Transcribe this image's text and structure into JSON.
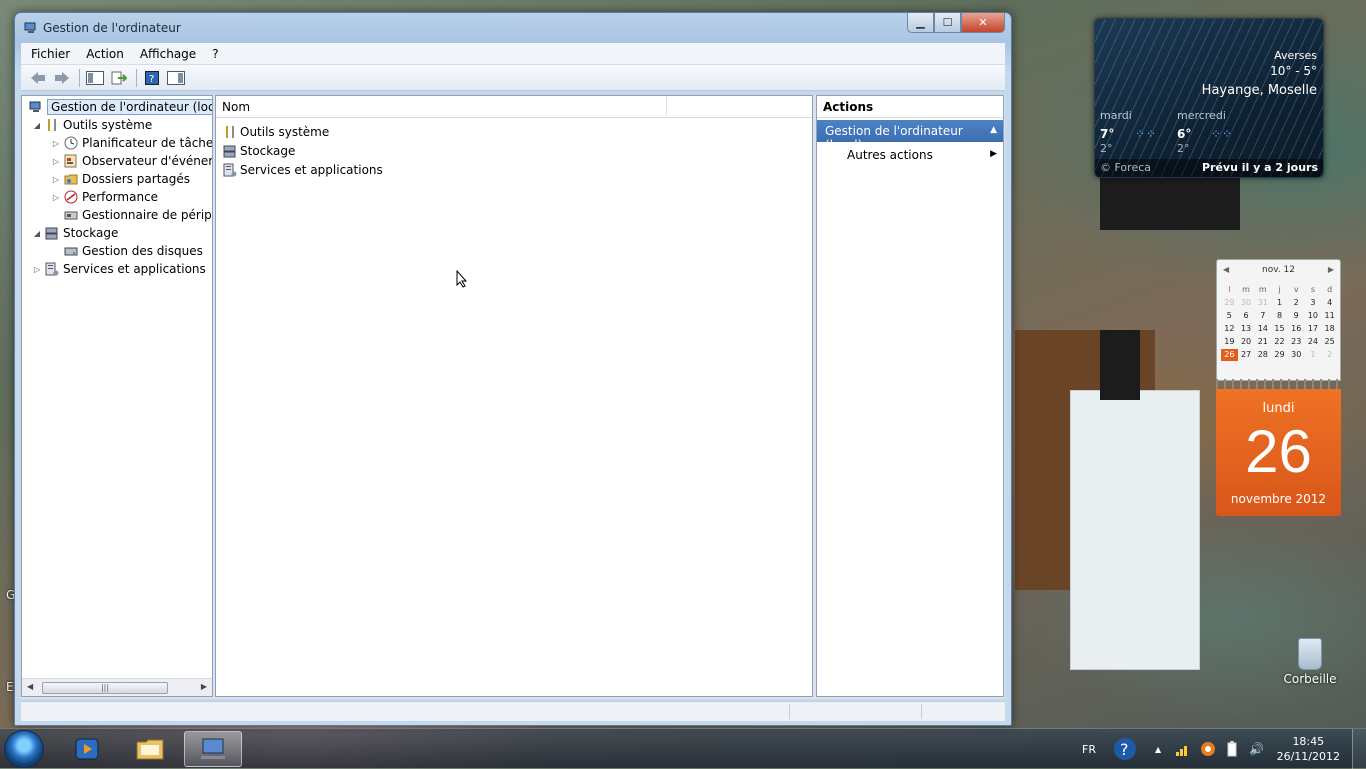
{
  "window": {
    "title": "Gestion de l'ordinateur",
    "controls": {
      "minimize": "▁",
      "maximize": "☐",
      "close": "✕"
    }
  },
  "menu": [
    "Fichier",
    "Action",
    "Affichage",
    "?"
  ],
  "toolbar": {
    "back_icon": "back-arrow-icon",
    "forward_icon": "forward-arrow-icon",
    "tree_icon": "show-hide-tree-icon",
    "export_icon": "export-list-icon",
    "help_icon": "help-icon",
    "actionpane_icon": "show-hide-action-pane-icon"
  },
  "tree": {
    "root": "Gestion de l'ordinateur (local)",
    "items": [
      {
        "label": "Outils système",
        "expander": "◢"
      },
      {
        "label": "Planificateur de tâches",
        "expander": "▷"
      },
      {
        "label": "Observateur d'événeme",
        "expander": "▷"
      },
      {
        "label": "Dossiers partagés",
        "expander": "▷"
      },
      {
        "label": "Performance",
        "expander": "▷"
      },
      {
        "label": "Gestionnaire de périphé",
        "expander": ""
      },
      {
        "label": "Stockage",
        "expander": "◢"
      },
      {
        "label": "Gestion des disques",
        "expander": ""
      },
      {
        "label": "Services et applications",
        "expander": "▷"
      }
    ],
    "scroll": {
      "left": "◀",
      "right": "▶",
      "thumb": "|||"
    }
  },
  "list": {
    "column_header": "Nom",
    "rows": [
      "Outils système",
      "Stockage",
      "Services et applications"
    ]
  },
  "actions": {
    "title": "Actions",
    "group": "Gestion de l'ordinateur (local)",
    "group_arrow": "▲",
    "item": "Autres actions",
    "item_arrow": "▶"
  },
  "weather": {
    "condition": "Averses",
    "range": "10° - 5°",
    "location": "Hayange, Moselle",
    "forecast": [
      {
        "day": "mardi",
        "high": "7°",
        "low": "2°"
      },
      {
        "day": "mercredi",
        "high": "6°",
        "low": "2°"
      }
    ],
    "source": "© Foreca",
    "updated": "Prévu il y a 2 jours"
  },
  "calendar": {
    "month_header": "nov. 12",
    "prev": "◀",
    "next": "▶",
    "day_headers": [
      "l",
      "m",
      "m",
      "j",
      "v",
      "s",
      "d"
    ],
    "weeks": [
      [
        "29",
        "30",
        "31",
        "1",
        "2",
        "3",
        "4"
      ],
      [
        "5",
        "6",
        "7",
        "8",
        "9",
        "10",
        "11"
      ],
      [
        "12",
        "13",
        "14",
        "15",
        "16",
        "17",
        "18"
      ],
      [
        "19",
        "20",
        "21",
        "22",
        "23",
        "24",
        "25"
      ],
      [
        "26",
        "27",
        "28",
        "29",
        "30",
        "1",
        "2"
      ]
    ],
    "today_index": [
      4,
      0
    ],
    "weekday": "lundi",
    "day_number": "26",
    "month_year": "novembre 2012"
  },
  "desktop": {
    "recycle_bin": "Corbeille",
    "edge_g": "G",
    "edge_e": "E"
  },
  "taskbar": {
    "language": "FR",
    "time": "18:45",
    "date": "26/11/2012",
    "tray_up": "▲",
    "volume_icon": "🔊"
  },
  "colors": {
    "accent": "#3a6eb0",
    "calendar_orange": "#e0601c"
  }
}
